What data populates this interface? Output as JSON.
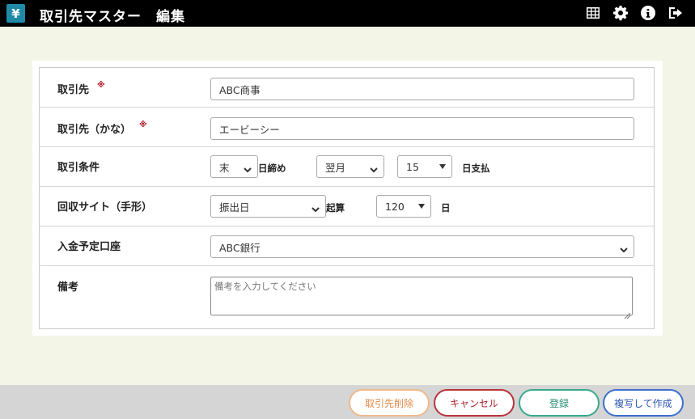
{
  "app": {
    "logo": "¥",
    "title": "取引先マスター　編集"
  },
  "header_icons": [
    "table-icon",
    "gear-icon",
    "info-icon",
    "logout-icon"
  ],
  "form": {
    "partner": {
      "label": "取引先",
      "required_mark": "※",
      "value": "ABC商事"
    },
    "partner_kana": {
      "label": "取引先（かな）",
      "required_mark": "※",
      "value": "エービーシー"
    },
    "terms": {
      "label": "取引条件",
      "closing_day": "末",
      "closing_suffix": "日締め",
      "payment_month": "翌月",
      "payment_day": "15",
      "payment_suffix": "日支払"
    },
    "collection_site": {
      "label": "回収サイト（手形）",
      "base": "振出日",
      "base_suffix": "起算",
      "days": "120",
      "days_suffix": "日"
    },
    "deposit_account": {
      "label": "入金予定口座",
      "value": "ABC銀行"
    },
    "remarks": {
      "label": "備考",
      "placeholder": "備考を入力してください"
    }
  },
  "buttons": {
    "delete": "取引先削除",
    "cancel": "キャンセル",
    "save": "登録",
    "copy_create": "複写して作成"
  },
  "colors": {
    "header_bg": "#000000",
    "page_bg": "#f3f5e6",
    "logo_bg": "#1f8aa8",
    "required": "#b0182a",
    "delete": "#e08b49",
    "cancel": "#a8242c",
    "save": "#2a8f74",
    "copy": "#2c56b2"
  }
}
